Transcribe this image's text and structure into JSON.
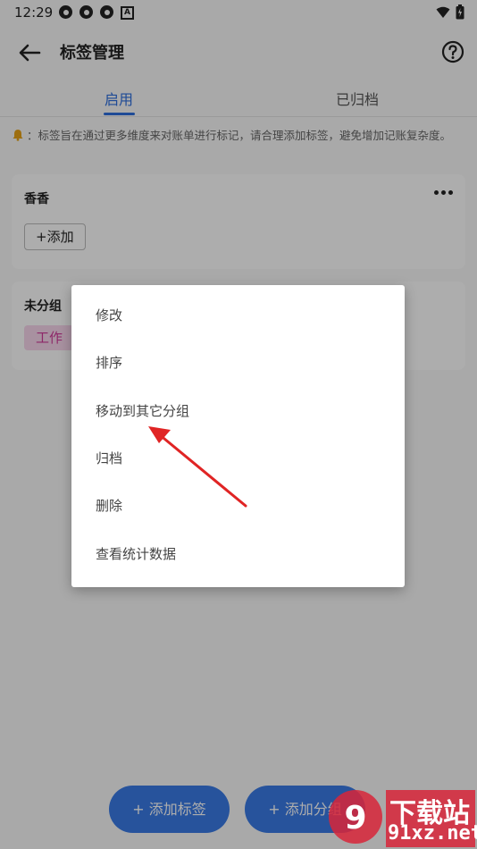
{
  "status_bar": {
    "time": "12:29"
  },
  "header": {
    "title": "标签管理"
  },
  "tabs": [
    {
      "label": "启用"
    },
    {
      "label": "已归档"
    }
  ],
  "notice": "：标签旨在通过更多维度来对账单进行标记，请合理添加标签，避免增加记账复杂度。",
  "groups": [
    {
      "name": "香香",
      "add_label": "+添加"
    },
    {
      "name": "未分组",
      "tag": "工作"
    }
  ],
  "bottom_actions": {
    "add_tag": "+ 添加标签",
    "add_group": "+ 添加分组"
  },
  "context_menu": {
    "items": [
      {
        "label": "修改"
      },
      {
        "label": "排序"
      },
      {
        "label": "移动到其它分组"
      },
      {
        "label": "归档"
      },
      {
        "label": "删除"
      },
      {
        "label": "查看统计数据"
      }
    ]
  },
  "watermark": {
    "text": "下载站",
    "url": "91xz.net"
  },
  "colors": {
    "accent": "#2f6fde",
    "button_blue": "#3a7be6",
    "tag_bg": "#f8d6ec",
    "tag_text": "#d0389a",
    "arrow": "#e02424"
  }
}
